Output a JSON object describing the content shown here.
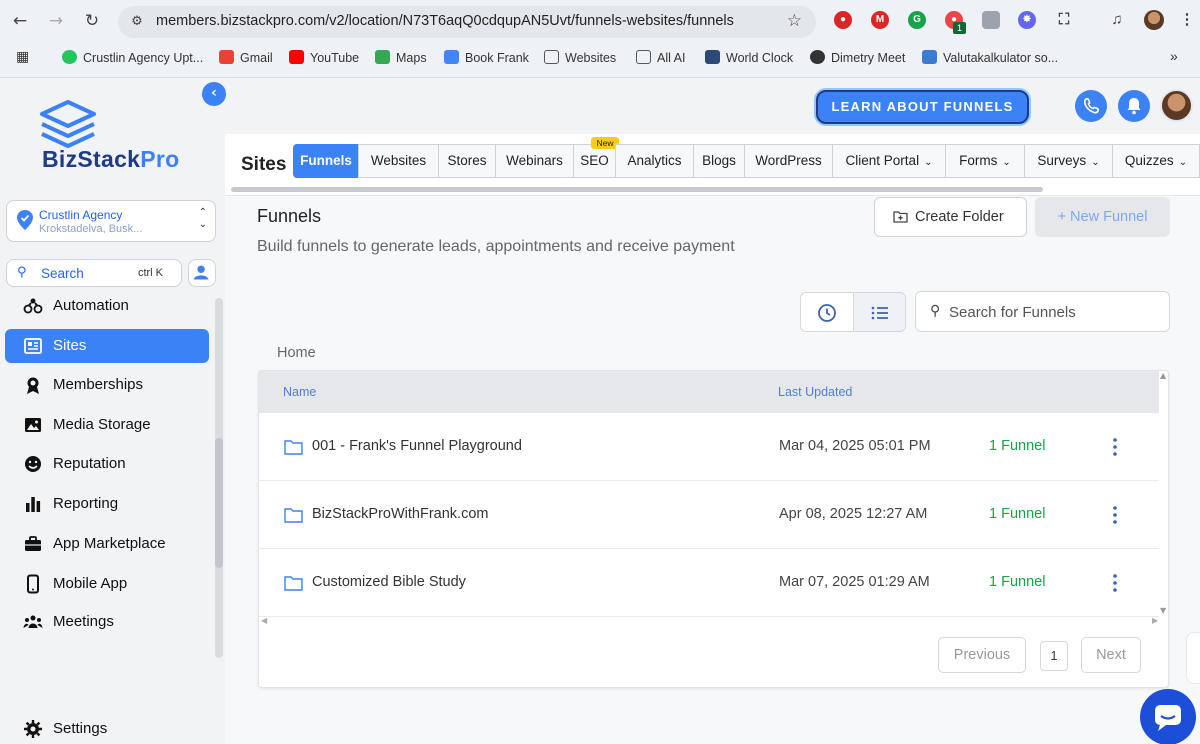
{
  "browser": {
    "url": "members.bizstackpro.com/v2/location/N73T6aqQ0cdqupAN5Uvt/funnels-websites/funnels",
    "extension_badge": "1",
    "bookmarks": [
      {
        "label": "Crustlin Agency Upt...",
        "color": "#22c55e"
      },
      {
        "label": "Gmail",
        "color": "#ea4335"
      },
      {
        "label": "YouTube",
        "color": "#ff0000"
      },
      {
        "label": "Maps",
        "color": "#34a853"
      },
      {
        "label": "Book Frank",
        "color": "#4285f4"
      },
      {
        "label": "Websites",
        "color": "#555555"
      },
      {
        "label": "All AI",
        "color": "#555555"
      },
      {
        "label": "World Clock",
        "color": "#2b4a7a"
      },
      {
        "label": "Dimetry Meet",
        "color": "#333333"
      },
      {
        "label": "Valutakalkulator so...",
        "color": "#3a7bd5"
      }
    ]
  },
  "sidebar": {
    "logo_biz": "BizStack",
    "logo_pro": "Pro",
    "agency_name": "Crustlin Agency",
    "agency_location": "Krokstadelva, Busk...",
    "search_label": "Search",
    "search_shortcut": "ctrl K",
    "items": [
      {
        "label": "Automation",
        "icon": "automation-icon"
      },
      {
        "label": "Sites",
        "icon": "sites-icon",
        "active": true
      },
      {
        "label": "Memberships",
        "icon": "memberships-icon"
      },
      {
        "label": "Media Storage",
        "icon": "media-storage-icon"
      },
      {
        "label": "Reputation",
        "icon": "reputation-icon"
      },
      {
        "label": "Reporting",
        "icon": "reporting-icon"
      },
      {
        "label": "App Marketplace",
        "icon": "app-marketplace-icon"
      },
      {
        "label": "Mobile App",
        "icon": "mobile-app-icon"
      },
      {
        "label": "Meetings",
        "icon": "meetings-icon"
      }
    ],
    "settings_label": "Settings"
  },
  "header": {
    "learn_button": "LEARN ABOUT FUNNELS"
  },
  "sites": {
    "title": "Sites",
    "tabs": [
      {
        "label": "Funnels",
        "active": true
      },
      {
        "label": "Websites"
      },
      {
        "label": "Stores"
      },
      {
        "label": "Webinars"
      },
      {
        "label": "SEO",
        "badge": "New"
      },
      {
        "label": "Analytics"
      },
      {
        "label": "Blogs"
      },
      {
        "label": "WordPress"
      },
      {
        "label": "Client Portal",
        "dropdown": true
      },
      {
        "label": "Forms",
        "dropdown": true
      },
      {
        "label": "Surveys",
        "dropdown": true
      },
      {
        "label": "Quizzes",
        "dropdown": true
      }
    ]
  },
  "funnels": {
    "title": "Funnels",
    "subtitle": "Build funnels to generate leads, appointments and receive payment",
    "create_folder": "Create Folder",
    "new_funnel": "+ New Funnel",
    "search_placeholder": "Search for Funnels",
    "breadcrumb": "Home",
    "columns": {
      "name": "Name",
      "last_updated": "Last Updated"
    },
    "rows": [
      {
        "name": "001 - Frank's Funnel Playground",
        "updated": "Mar 04, 2025 05:01 PM",
        "count": "1 Funnel"
      },
      {
        "name": "BizStackProWithFrank.com",
        "updated": "Apr 08, 2025 12:27 AM",
        "count": "1 Funnel"
      },
      {
        "name": "Customized Bible Study",
        "updated": "Mar 07, 2025 01:29 AM",
        "count": "1 Funnel"
      }
    ],
    "pagination": {
      "previous": "Previous",
      "page": "1",
      "next": "Next"
    }
  },
  "colors": {
    "accent": "#3b82f6",
    "brand_dark": "#1e3a8a",
    "success": "#16a34a"
  }
}
